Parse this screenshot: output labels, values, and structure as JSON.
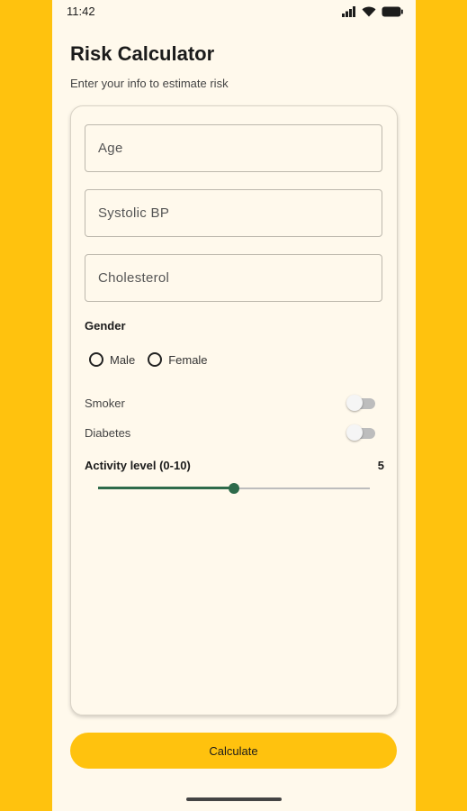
{
  "status_bar": {
    "time": "11:42",
    "icons": [
      "signal-icon",
      "wifi-icon",
      "battery-icon"
    ]
  },
  "header": {
    "title": "Risk Calculator",
    "subtitle": "Enter your info to estimate risk"
  },
  "form": {
    "age_placeholder": "Age",
    "bp_placeholder": "Systolic BP",
    "cholesterol_placeholder": "Cholesterol",
    "gender_label": "Gender",
    "gender_options": [
      "Male",
      "Female"
    ],
    "gender_selected": null,
    "smoker_label": "Smoker",
    "smoker_on": false,
    "diabetes_label": "Diabetes",
    "diabetes_on": false,
    "activity_label": "Activity level (0-10)",
    "activity_value": "5",
    "activity_min": 0,
    "activity_max": 10
  },
  "actions": {
    "calculate_label": "Calculate"
  },
  "colors": {
    "accent": "#FFC20E",
    "background": "#FFF9EC",
    "slider": "#2E6B4B"
  }
}
